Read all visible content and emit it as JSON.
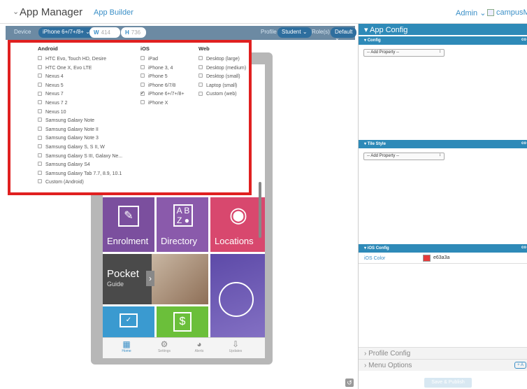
{
  "header": {
    "title": "App Manager",
    "subtitle": "App Builder",
    "admin": "Admin",
    "account": "campusM"
  },
  "toolbar": {
    "device_label": "Device",
    "device_value": "iPhone 6+/7+/8+",
    "width_label": "W",
    "width_value": "414",
    "height_label": "H",
    "height_value": "736",
    "profile_label": "Profile",
    "profile_value": "Student",
    "role_label": "Role(s)",
    "role_value": "Default"
  },
  "device_menu": {
    "columns": [
      {
        "title": "Android",
        "options": [
          {
            "label": "HTC Evo, Touch HD, Desire",
            "checked": false
          },
          {
            "label": "HTC One X, Evo LTE",
            "checked": false
          },
          {
            "label": "Nexus 4",
            "checked": false
          },
          {
            "label": "Nexus 5",
            "checked": false
          },
          {
            "label": "Nexus 7",
            "checked": false
          },
          {
            "label": "Nexus 7 2",
            "checked": false
          },
          {
            "label": "Nexus 10",
            "checked": false
          },
          {
            "label": "Samsung Galaxy Note",
            "checked": false
          },
          {
            "label": "Samsung Galaxy Note II",
            "checked": false
          },
          {
            "label": "Samsung Galaxy Note 3",
            "checked": false
          },
          {
            "label": "Samsung Galaxy S, S II, W",
            "checked": false
          },
          {
            "label": "Samsung Galaxy S III, Galaxy Ne...",
            "checked": false
          },
          {
            "label": "Samsung Galaxy S4",
            "checked": false
          },
          {
            "label": "Samsung Galaxy Tab 7.7, 8.9, 10.1",
            "checked": false
          },
          {
            "label": "Custom (Android)",
            "checked": false
          }
        ]
      },
      {
        "title": "iOS",
        "options": [
          {
            "label": "iPad",
            "checked": false
          },
          {
            "label": "iPhone 3, 4",
            "checked": false
          },
          {
            "label": "iPhone 5",
            "checked": false
          },
          {
            "label": "iPhone 6/7/8",
            "checked": false
          },
          {
            "label": "iPhone 6+/7+/8+",
            "checked": true
          },
          {
            "label": "iPhone X",
            "checked": false
          }
        ]
      },
      {
        "title": "Web",
        "options": [
          {
            "label": "Desktop (large)",
            "checked": false
          },
          {
            "label": "Desktop (medium)",
            "checked": false
          },
          {
            "label": "Desktop (small)",
            "checked": false
          },
          {
            "label": "Laptop (small)",
            "checked": false
          },
          {
            "label": "Custom (web)",
            "checked": false
          }
        ]
      }
    ]
  },
  "phone": {
    "tiles": [
      {
        "label": "Enrolment",
        "color": "#7b4f9e",
        "icon": "enrolment-icon"
      },
      {
        "label": "Directory",
        "color": "#8a5aab",
        "icon": "directory-icon"
      },
      {
        "label": "Locations",
        "color": "#d8486e",
        "icon": "location-pin-icon"
      },
      {
        "label": "Pocket",
        "sublabel": "Guide",
        "color": "#4a4a4a",
        "icon": "pocket-guide-icon"
      }
    ],
    "tabs": [
      {
        "label": "Home",
        "active": true
      },
      {
        "label": "Settings",
        "active": false
      },
      {
        "label": "Alerts",
        "active": false
      },
      {
        "label": "Updates",
        "active": false
      }
    ]
  },
  "right_panel": {
    "title": "App Config",
    "config_section": "Config",
    "tile_style_section": "Tile Style",
    "ios_config_section": "iOS Config",
    "section_right": "co",
    "add_property": "-- Add Property --",
    "ios_color_label": "iOS Color",
    "ios_color_value": "e63a3a",
    "ios_color_hex": "#e63a3a",
    "profile_config": "Profile Config",
    "menu_options": "Menu Options",
    "add_label": "+ A",
    "save_publish": "Save & Publish"
  }
}
